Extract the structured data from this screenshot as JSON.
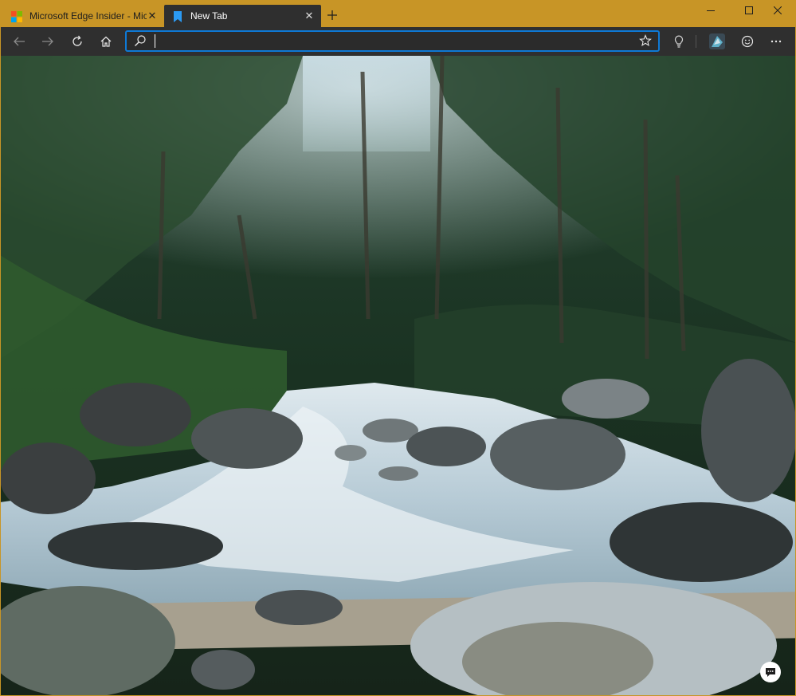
{
  "tabs": [
    {
      "title": "Microsoft Edge Insider - Microsoft Edge Insider",
      "active": false,
      "favicon": "microsoft-logo-icon"
    },
    {
      "title": "New Tab",
      "active": true,
      "favicon": "bookmark-tab-icon"
    }
  ],
  "address_bar": {
    "value": "",
    "placeholder": ""
  },
  "colors": {
    "titlebar": "#c89526",
    "toolbar": "#2f2f2f",
    "accent": "#0e79d6"
  },
  "toolbar_icons": [
    "back-icon",
    "forward-icon",
    "refresh-icon",
    "home-icon",
    "search-icon",
    "favorite-star-icon",
    "tracking-light-icon",
    "profile-avatar-icon",
    "feedback-smiley-icon",
    "more-icon"
  ],
  "window_controls": [
    "minimize",
    "maximize",
    "close"
  ]
}
